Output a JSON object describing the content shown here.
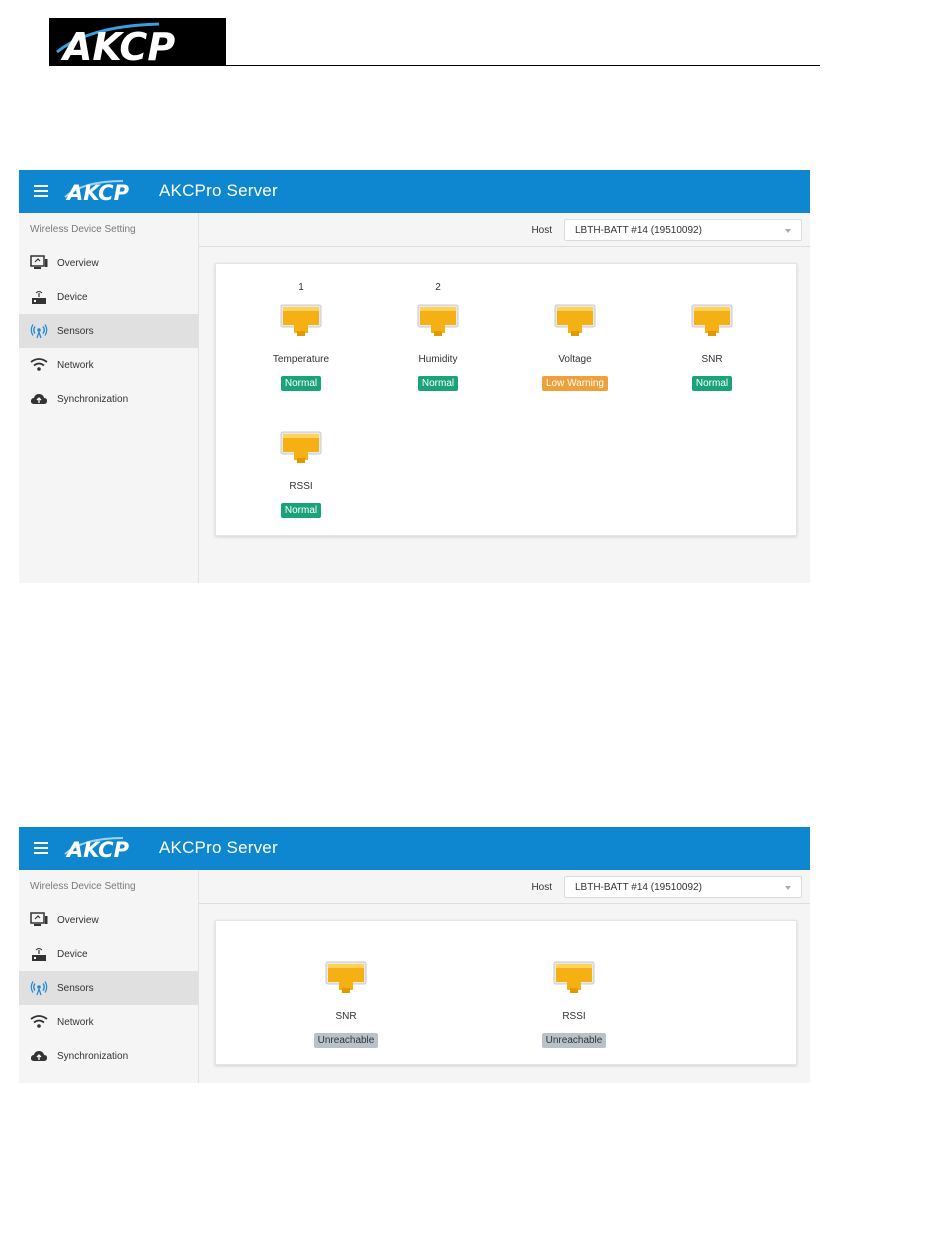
{
  "doc_header": {
    "logo_text": "AKCP"
  },
  "panels": [
    {
      "app": {
        "logo_text": "AKCP",
        "title": "AKCPro Server"
      },
      "sidebar": {
        "heading": "Wireless Device Setting",
        "items": [
          {
            "label": "Overview",
            "icon": "overview-icon"
          },
          {
            "label": "Device",
            "icon": "device-icon"
          },
          {
            "label": "Sensors",
            "icon": "sensors-icon",
            "active": true
          },
          {
            "label": "Network",
            "icon": "wifi-icon"
          },
          {
            "label": "Synchronization",
            "icon": "cloud-upload-icon"
          }
        ]
      },
      "host": {
        "label": "Host",
        "value": "LBTH-BATT #14 (19510092)"
      },
      "sensors": [
        {
          "index": "1",
          "name": "Temperature",
          "status": "Normal"
        },
        {
          "index": "2",
          "name": "Humidity",
          "status": "Normal"
        },
        {
          "index": "",
          "name": "Voltage",
          "status": "Low Warning"
        },
        {
          "index": "",
          "name": "SNR",
          "status": "Normal"
        },
        {
          "index": "",
          "name": "RSSI",
          "status": "Normal"
        }
      ]
    },
    {
      "app": {
        "logo_text": "AKCP",
        "title": "AKCPro Server"
      },
      "sidebar": {
        "heading": "Wireless Device Setting",
        "items": [
          {
            "label": "Overview",
            "icon": "overview-icon"
          },
          {
            "label": "Device",
            "icon": "device-icon"
          },
          {
            "label": "Sensors",
            "icon": "sensors-icon",
            "active": true
          },
          {
            "label": "Network",
            "icon": "wifi-icon"
          },
          {
            "label": "Synchronization",
            "icon": "cloud-upload-icon"
          }
        ]
      },
      "host": {
        "label": "Host",
        "value": "LBTH-BATT #14 (19510092)"
      },
      "sensors": [
        {
          "index": "",
          "name": "SNR",
          "status": "Unreachable"
        },
        {
          "index": "",
          "name": "RSSI",
          "status": "Unreachable"
        }
      ]
    }
  ],
  "colors": {
    "topbar": "#0f87d0",
    "normal": "#1aa37a",
    "warning": "#eea13a",
    "unreachable": "#b9c2cb",
    "sensor_icon": "#f5b014"
  }
}
